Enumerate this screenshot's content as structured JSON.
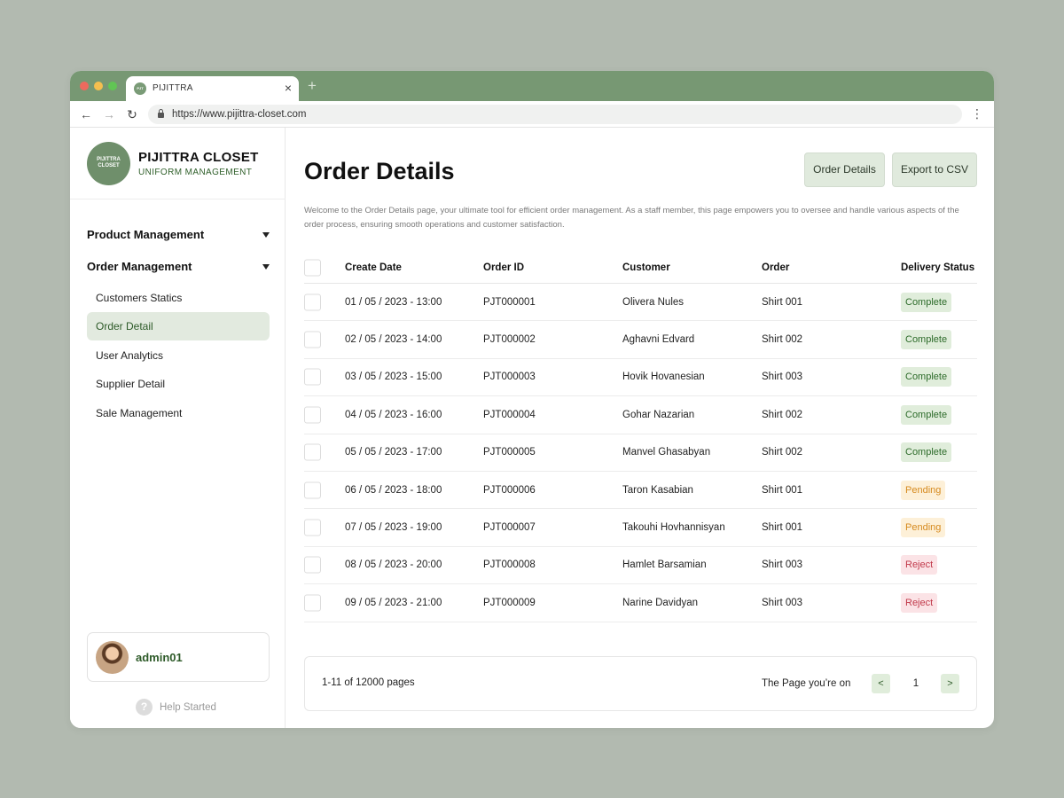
{
  "browser": {
    "tab_title": "PIJITTRA",
    "tab_close": "×",
    "new_tab": "+",
    "url": "https://www.pijittra-closet.com",
    "back": "←",
    "forward": "→",
    "reload": "↻",
    "menu": "⋮"
  },
  "brand": {
    "logo_text": "PIJITTRA CLOSET",
    "name": "PIJITTRA CLOSET",
    "subtitle": "UNIFORM MANAGEMENT"
  },
  "sidebar": {
    "groups": [
      {
        "label": "Product Management",
        "expanded": false
      },
      {
        "label": "Order Management",
        "expanded": true
      }
    ],
    "items": [
      {
        "label": "Customers Statics",
        "active": false
      },
      {
        "label": "Order Detail",
        "active": true
      },
      {
        "label": "User Analytics",
        "active": false
      },
      {
        "label": "Supplier Detail",
        "active": false
      },
      {
        "label": "Sale Management",
        "active": false
      }
    ],
    "user": {
      "name": "admin01"
    },
    "help": {
      "icon": "?",
      "label": "Help Started"
    }
  },
  "main": {
    "title": "Order Details",
    "buttons": {
      "details": "Order Details",
      "export": "Export to CSV"
    },
    "description": "Welcome to the Order Details page, your ultimate tool for efficient order management. As a staff member, this page empowers you to oversee and handle various aspects of the order process, ensuring smooth operations and customer satisfaction.",
    "table": {
      "headers": [
        "Create Date",
        "Order ID",
        "Customer",
        "Order",
        "Delivery Status"
      ],
      "rows": [
        {
          "date": "01 / 05 / 2023 - 13:00",
          "id": "PJT000001",
          "customer": "Olivera Nules",
          "order": "Shirt 001",
          "status": "Complete"
        },
        {
          "date": "02 / 05 / 2023 - 14:00",
          "id": "PJT000002",
          "customer": "Aghavni Edvard",
          "order": "Shirt 002",
          "status": "Complete"
        },
        {
          "date": "03 / 05 / 2023 - 15:00",
          "id": "PJT000003",
          "customer": "Hovik Hovanesian",
          "order": "Shirt 003",
          "status": "Complete"
        },
        {
          "date": "04 / 05 / 2023 - 16:00",
          "id": "PJT000004",
          "customer": "Gohar Nazarian",
          "order": "Shirt 002",
          "status": "Complete"
        },
        {
          "date": "05 / 05 / 2023 - 17:00",
          "id": "PJT000005",
          "customer": "Manvel Ghasabyan",
          "order": "Shirt 002",
          "status": "Complete"
        },
        {
          "date": "06 / 05 / 2023 - 18:00",
          "id": "PJT000006",
          "customer": "Taron Kasabian",
          "order": "Shirt 001",
          "status": "Pending"
        },
        {
          "date": "07 / 05 / 2023 - 19:00",
          "id": "PJT000007",
          "customer": "Takouhi Hovhannisyan",
          "order": "Shirt 001",
          "status": "Pending"
        },
        {
          "date": "08 / 05 / 2023 - 20:00",
          "id": "PJT000008",
          "customer": "Hamlet Barsamian",
          "order": "Shirt 003",
          "status": "Reject"
        },
        {
          "date": "09 / 05 / 2023 - 21:00",
          "id": "PJT000009",
          "customer": "Narine Davidyan",
          "order": "Shirt 003",
          "status": "Reject"
        }
      ]
    },
    "pagination": {
      "info": "1-11 of 12000 pages",
      "label": "The Page you’re on",
      "prev": "<",
      "current": "1",
      "next": ">"
    }
  },
  "colors": {
    "accent": "#779873",
    "active_bg": "#e2eadf",
    "complete": "#2d6b2a",
    "pending": "#d68a1e",
    "reject": "#c1394a"
  }
}
